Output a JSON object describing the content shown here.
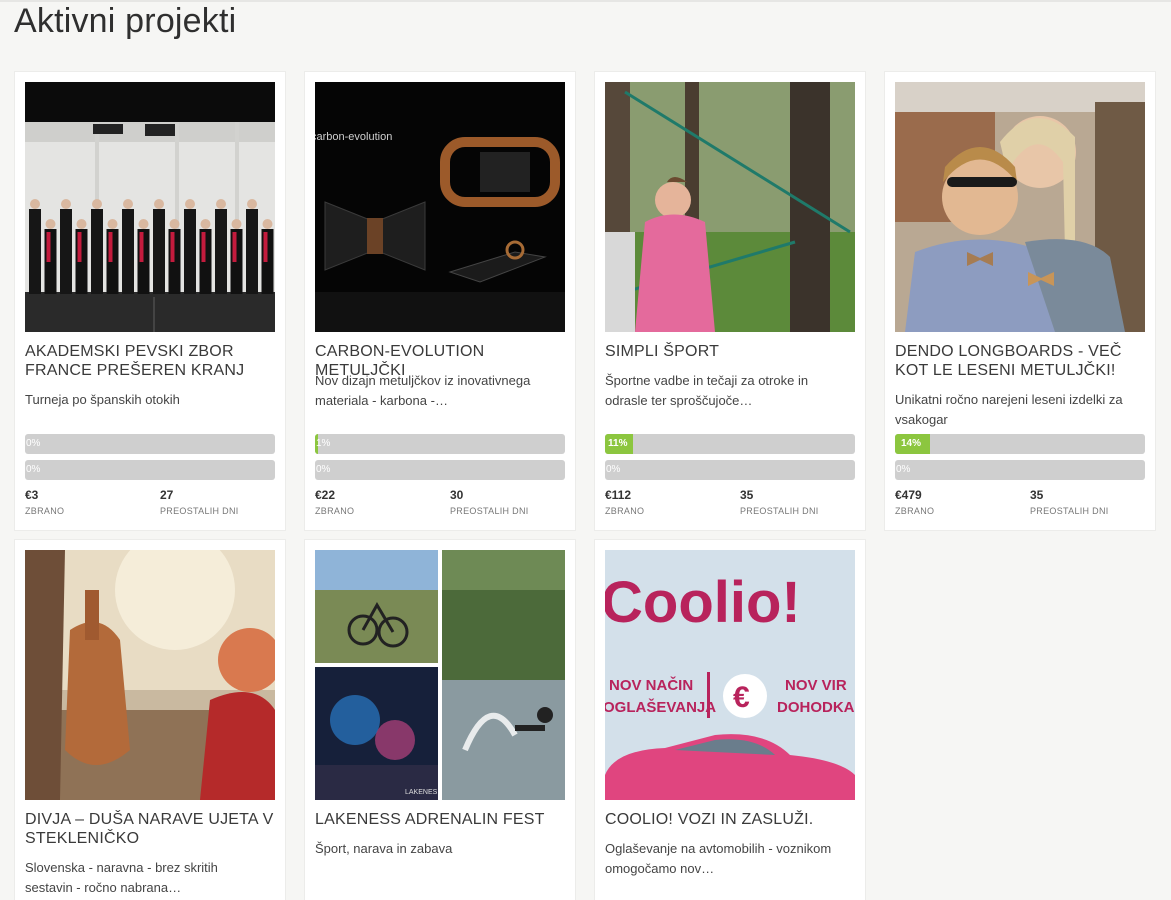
{
  "page": {
    "title": "Aktivni projekti"
  },
  "projects": [
    {
      "title": "AKADEMSKI PEVSKI ZBOR FRANCE PREŠEREN KRANJ",
      "desc": "Turneja po španskih otokih",
      "bar1_pct": "0%",
      "bar1_value": 0,
      "bar2_pct": "0%",
      "bar2_value": 0,
      "collected": "€3",
      "collected_label": "ZBRANO",
      "days": "27",
      "days_label": "PREOSTALIH DNI"
    },
    {
      "title": "CARBON-EVOLUTION METULJČKI",
      "desc": "Nov dizajn metuljčkov iz inovativnega materiala - karbona -…",
      "bar1_pct": "1%",
      "bar1_value": 1,
      "bar2_pct": "0%",
      "bar2_value": 0,
      "collected": "€22",
      "collected_label": "ZBRANO",
      "days": "30",
      "days_label": "PREOSTALIH DNI",
      "image_text": "carbon-evolution"
    },
    {
      "title": "SIMPLI ŠPORT",
      "desc": "Športne vadbe in tečaji za otroke in odrasle ter sproščujoče…",
      "bar1_pct": "11%",
      "bar1_value": 11,
      "bar2_pct": "0%",
      "bar2_value": 0,
      "collected": "€112",
      "collected_label": "ZBRANO",
      "days": "35",
      "days_label": "PREOSTALIH DNI"
    },
    {
      "title": "DENDO LONGBOARDS - VEČ KOT LE LESENI METULJČKI!",
      "desc": "Unikatni ročno narejeni leseni izdelki za vsakogar",
      "bar1_pct": "14%",
      "bar1_value": 14,
      "bar2_pct": "0%",
      "bar2_value": 0,
      "collected": "€479",
      "collected_label": "ZBRANO",
      "days": "35",
      "days_label": "PREOSTALIH DNI"
    },
    {
      "title": "DIVJA – DUŠA NARAVE UJETA V STEKLENIČKO",
      "desc": "Slovenska - naravna - brez skritih sestavin - ročno nabrana…"
    },
    {
      "title": "LAKENESS ADRENALIN FEST",
      "desc": "Šport, narava in zabava",
      "image_text": "LAKENES"
    },
    {
      "title": "COOLIO! VOZI IN ZASLUŽI.",
      "desc": "Oglaševanje na avtomobilih - voznikom omogočamo nov…",
      "image_logo": "Coolio!",
      "image_line1a": "NOV NAČIN",
      "image_line1b": "OGLAŠEVANJA",
      "image_line2a": "NOV VIR",
      "image_line2b": "DOHODKA",
      "image_euro": "€"
    }
  ],
  "colors": {
    "accent_green": "#8cc63f",
    "bar_bg": "#cfcfcf",
    "page_bg": "#f6f6f4",
    "coolio_pink": "#b8235c"
  }
}
